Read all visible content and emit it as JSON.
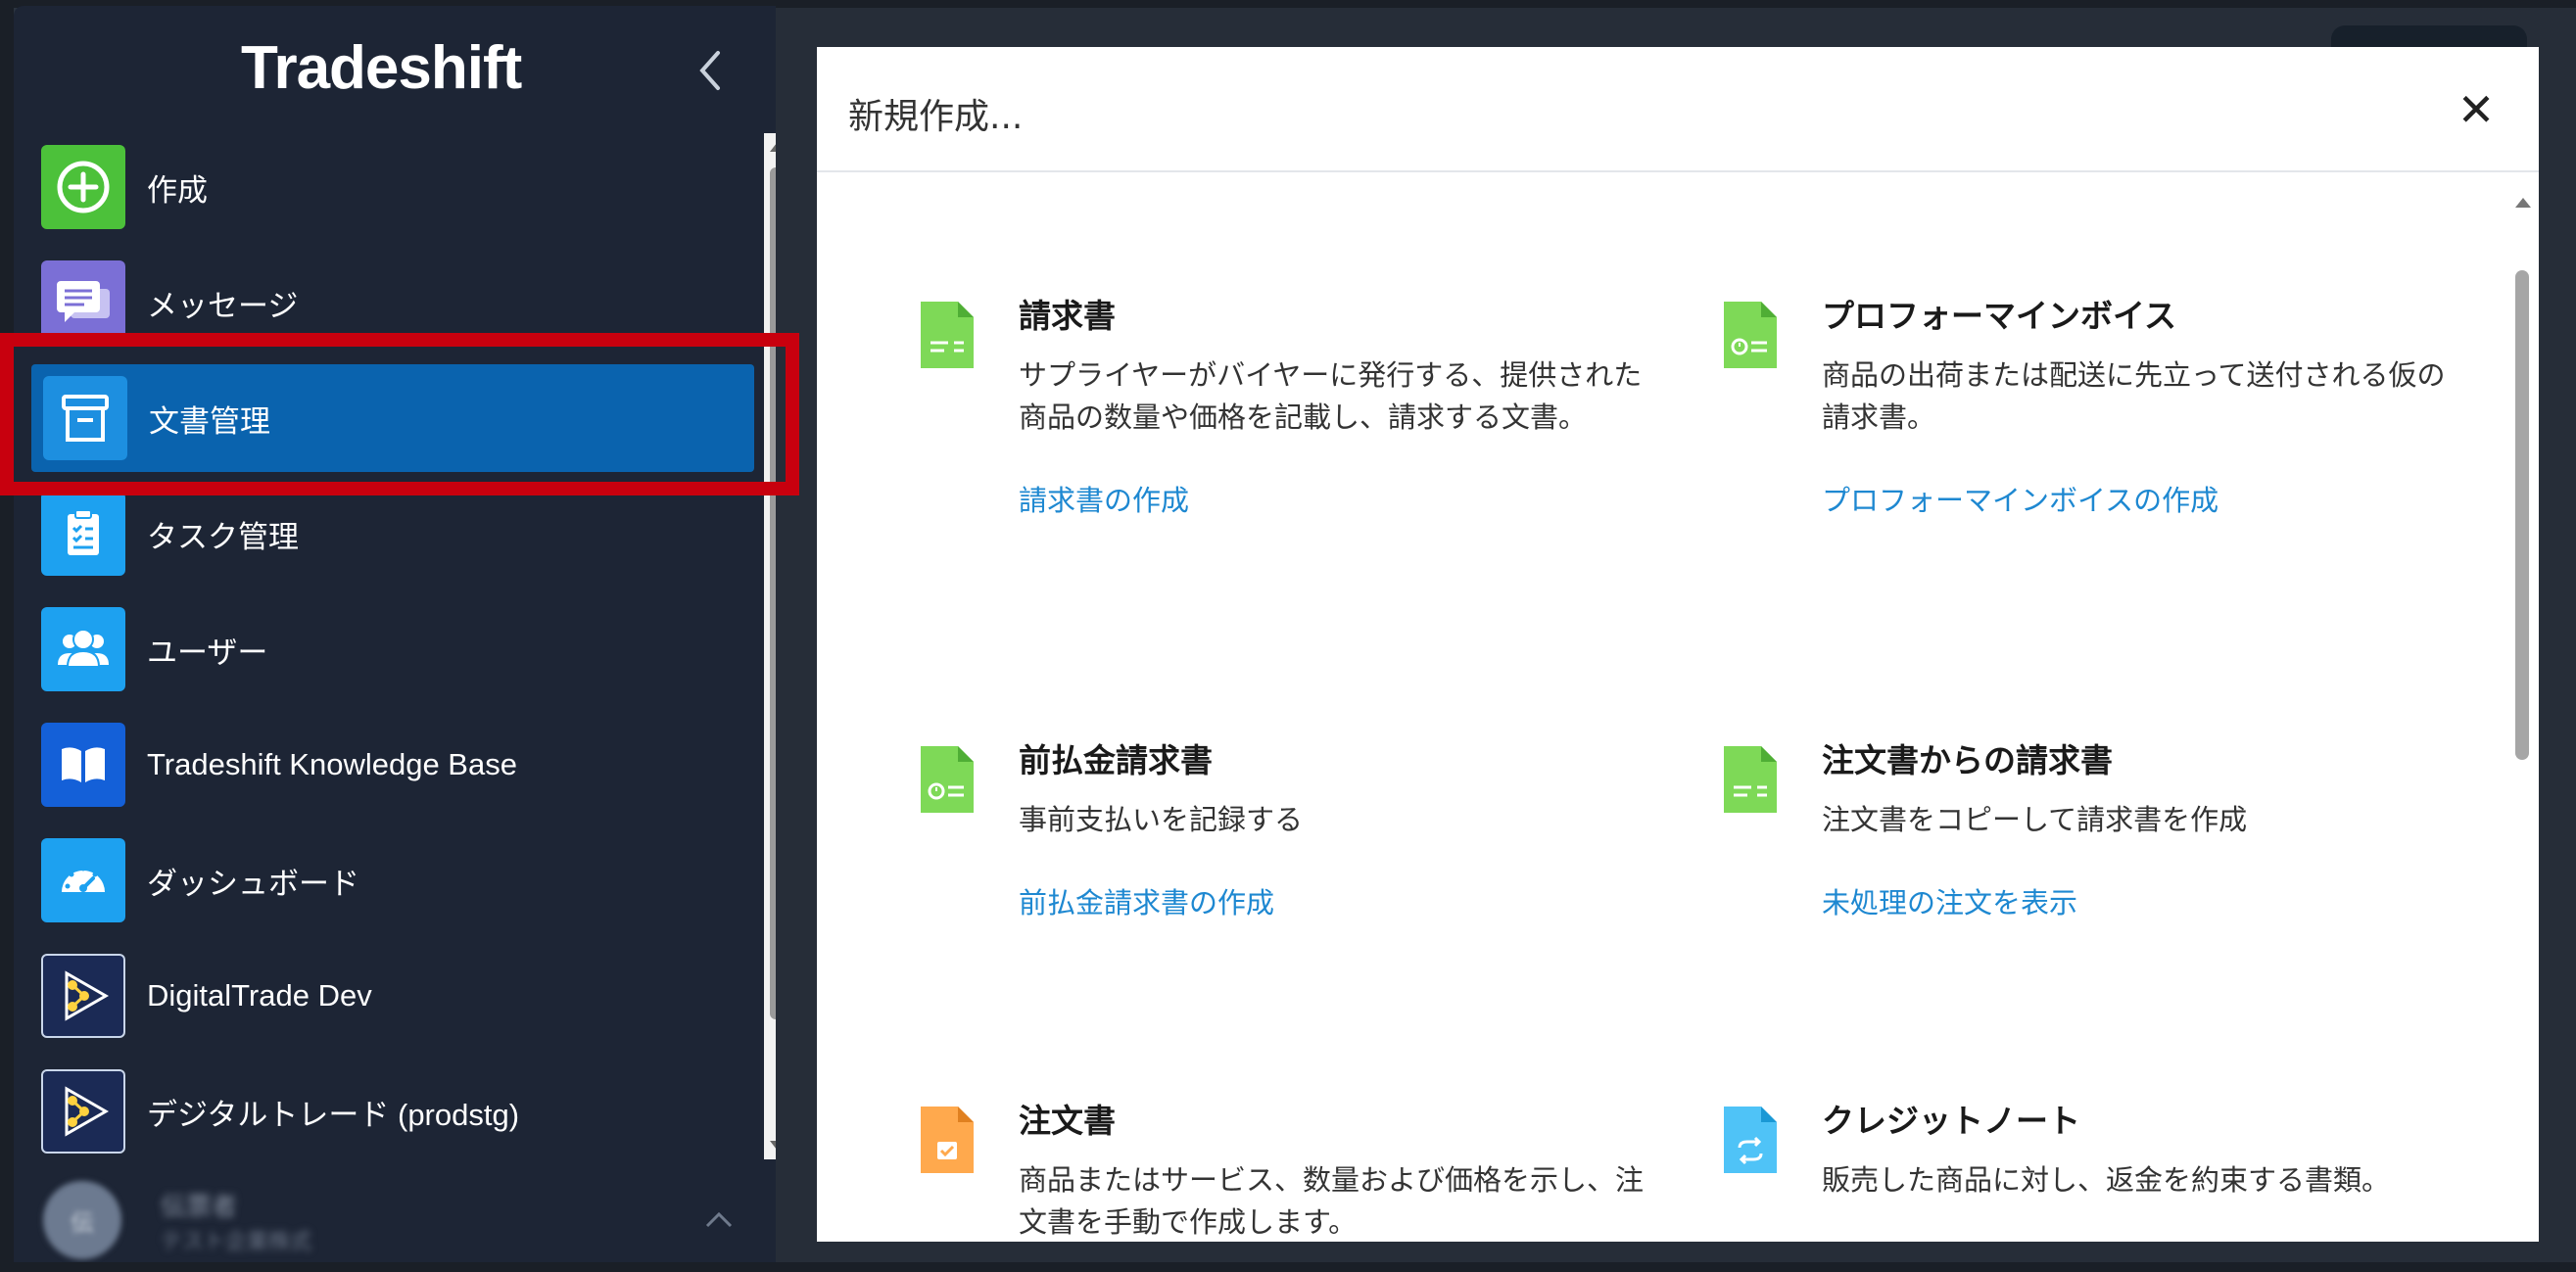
{
  "app": {
    "logo_text": "Tradeshift"
  },
  "sidebar": {
    "items": [
      {
        "label": "作成",
        "icon": "plus-circle-icon",
        "color": "#4cc13a"
      },
      {
        "label": "メッセージ",
        "icon": "messages-icon",
        "color": "#7b6fd6"
      },
      {
        "label": "文書管理",
        "icon": "file-cabinet-icon",
        "color": "#1d8fe0",
        "active": true
      },
      {
        "label": "タスク管理",
        "icon": "clipboard-checklist-icon",
        "color": "#1da1f0"
      },
      {
        "label": "ユーザー",
        "icon": "users-icon",
        "color": "#1da1f0"
      },
      {
        "label": "Tradeshift Knowledge Base",
        "icon": "book-icon",
        "color": "#1460d8"
      },
      {
        "label": "ダッシュボード",
        "icon": "speedometer-icon",
        "color": "#1da1f0"
      },
      {
        "label": "DigitalTrade Dev",
        "icon": "workflow-icon",
        "color": "#1b2a55"
      },
      {
        "label": "デジタルトレード (prodstg)",
        "icon": "workflow-icon",
        "color": "#1b2a55"
      }
    ],
    "user": {
      "initials": "伝",
      "name": "伝票者",
      "org": "テスト企業株式"
    }
  },
  "modal": {
    "title": "新規作成...",
    "close_label": "✕",
    "cards": [
      {
        "title": "請求書",
        "description": "サプライヤーがバイヤーに発行する、提供された商品の数量や価格を記載し、請求する文書。",
        "link": "請求書の作成",
        "icon": "invoice-doc-icon",
        "icon_color": "#7ed957"
      },
      {
        "title": "プロフォーマインボイス",
        "description": "商品の出荷または配送に先立って送付される仮の請求書。",
        "link": "プロフォーマインボイスの作成",
        "icon": "proforma-doc-icon",
        "icon_color": "#7ed957"
      },
      {
        "title": "前払金請求書",
        "description": "事前支払いを記録する",
        "link": "前払金請求書の作成",
        "icon": "prepayment-doc-icon",
        "icon_color": "#7ed957"
      },
      {
        "title": "注文書からの請求書",
        "description": "注文書をコピーして請求書を作成",
        "link": "未処理の注文を表示",
        "icon": "po-invoice-doc-icon",
        "icon_color": "#7ed957"
      },
      {
        "title": "注文書",
        "description": "商品またはサービス、数量および価格を示し、注文書を手動で作成します。",
        "link": "",
        "icon": "order-doc-icon",
        "icon_color": "#ffa94d"
      },
      {
        "title": "クレジットノート",
        "description": "販売した商品に対し、返金を約束する書類。",
        "link": "",
        "icon": "credit-note-doc-icon",
        "icon_color": "#4fc3f7"
      }
    ]
  }
}
